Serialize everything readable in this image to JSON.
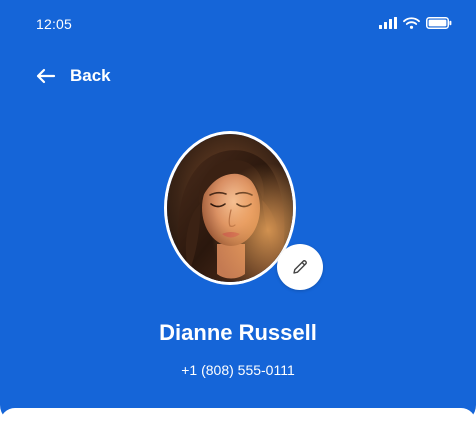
{
  "status_bar": {
    "time": "12:05",
    "icons": [
      "signal-icon",
      "wifi-icon",
      "battery-icon"
    ]
  },
  "nav": {
    "back_label": "Back",
    "back_icon": "arrow-left-icon"
  },
  "profile": {
    "name": "Dianne Russell",
    "phone": "+1 (808) 555-0111",
    "edit_icon": "pencil-icon"
  },
  "colors": {
    "header_background": "#1565d8",
    "text": "#ffffff",
    "edit_button": "#ffffff"
  }
}
